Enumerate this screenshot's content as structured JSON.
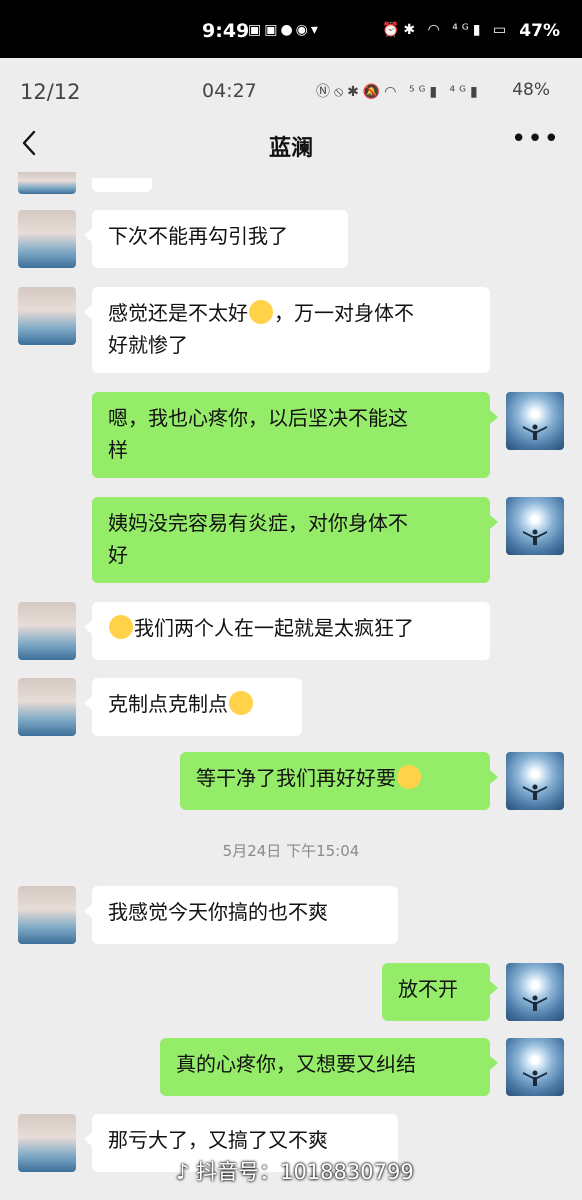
{
  "outer_status": {
    "time": "9:49",
    "battery": "47%",
    "icons_left": "▣▣●◉▾",
    "icons_right": "⏰✱ ◠ ⁴ᴳ▮ ▭"
  },
  "inner_status": {
    "page_counter": "12/12",
    "time": "04:27",
    "icons": "Ⓝ⦸✱🔕◠ ⁵ᴳ▮ ⁴ᴳ▮",
    "battery": "48%"
  },
  "nav": {
    "title": "蓝澜",
    "back_icon": "chevron-left-icon",
    "more_icon": "more-dots-icon",
    "more_glyph": "•••"
  },
  "messages": [
    {
      "side": "in",
      "text": "下次不能再勾引我了"
    },
    {
      "side": "in",
      "lines": [
        "感觉还是不太好",
        "😂",
        "，万一对身体不",
        "好就惨了"
      ]
    },
    {
      "side": "out",
      "lines": [
        "嗯，我也心疼你，以后坚决不能这",
        "样"
      ]
    },
    {
      "side": "out",
      "lines": [
        "姨妈没完容易有炎症，对你身体不",
        "好"
      ]
    },
    {
      "side": "in",
      "emoji": "🤔",
      "text": "我们两个人在一起就是太疯狂了"
    },
    {
      "side": "in",
      "text": "克制点克制点",
      "emoji": "😵"
    },
    {
      "side": "out",
      "text": "等干净了我们再好好要",
      "emoji": "😌"
    },
    {
      "side": "in",
      "text": "我感觉今天你搞的也不爽"
    },
    {
      "side": "out",
      "text": "放不开"
    },
    {
      "side": "out",
      "text": "真的心疼你，又想要又纠结"
    },
    {
      "side": "in",
      "text": "那亏大了，又搞了又不爽"
    }
  ],
  "timestamp": "5月24日 下午15:04",
  "watermark": "抖音号：1018830799",
  "colors": {
    "background": "#ededed",
    "incoming_bubble": "#ffffff",
    "outgoing_bubble": "#95ec69"
  }
}
